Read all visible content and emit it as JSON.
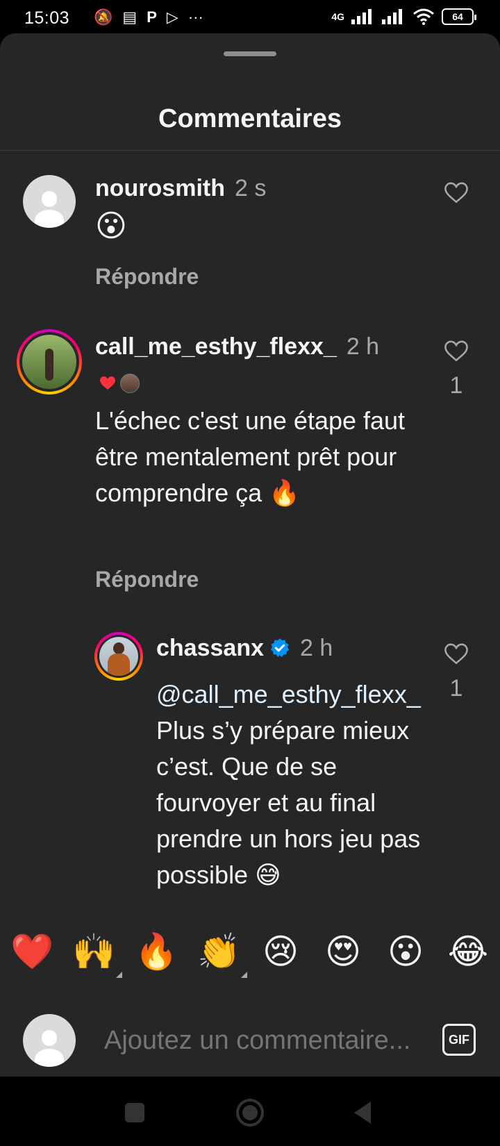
{
  "status_bar": {
    "time": "15:03",
    "network": "4G",
    "battery": "64",
    "more": "···"
  },
  "sheet": {
    "title": "Commentaires"
  },
  "comments": [
    {
      "username": "nourosmith",
      "time": "2 s",
      "text": "😮",
      "reply_label": "Répondre"
    },
    {
      "username": "call_me_esthy_flexx_",
      "time": "2 h",
      "text": "L'échec c'est une étape faut être mentalement prêt pour comprendre ça 🔥",
      "reply_label": "Répondre",
      "like_count": "1",
      "liked_by_author": true
    }
  ],
  "reply": {
    "username": "chassanx",
    "verified": true,
    "time": "2 h",
    "mention": "@call_me_esthy_flexx_",
    "text": " Plus s’y prépare mieux c’est. Que de se fourvoyer et au final prendre un hors jeu pas possible 😅",
    "like_count": "1"
  },
  "quick_reactions": [
    "❤️",
    "🙌",
    "🔥",
    "👏",
    "😢",
    "😍",
    "😮",
    "😂"
  ],
  "composer": {
    "placeholder": "Ajoutez un commentaire...",
    "gif_label": "GIF"
  },
  "colors": {
    "sheet_bg": "#262626",
    "secondary_text": "#a8a8a8",
    "verified_blue": "#0095f6",
    "like_red": "#ff3040"
  }
}
